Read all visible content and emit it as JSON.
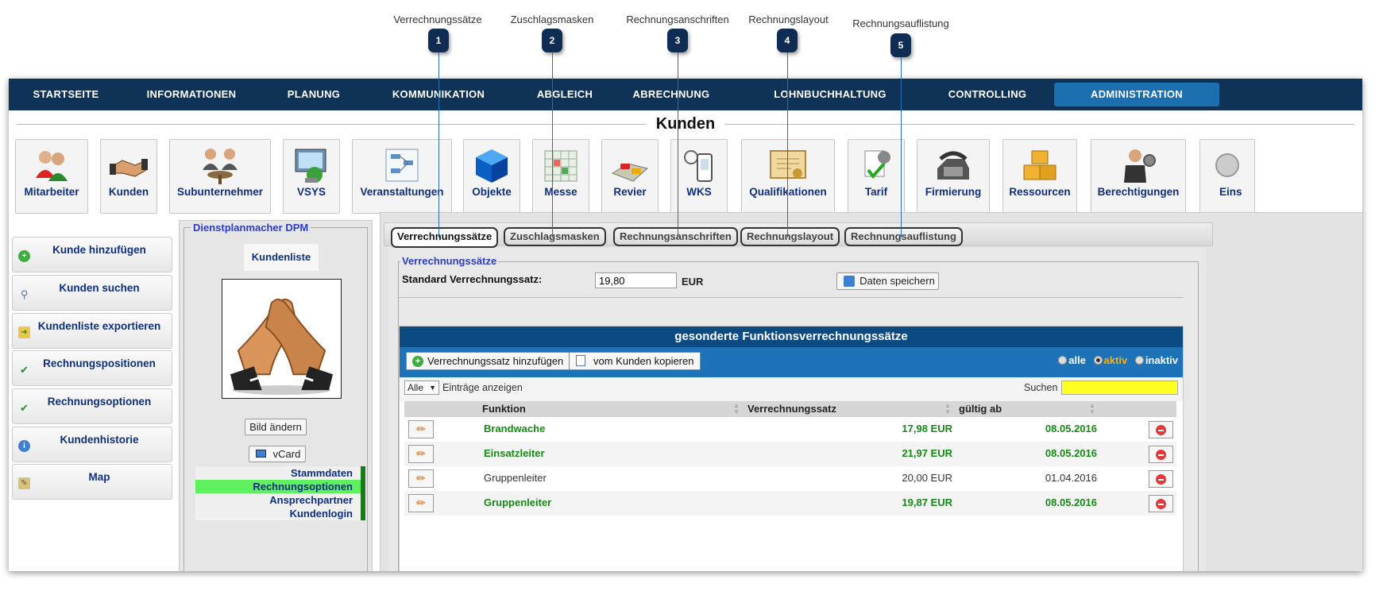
{
  "callouts": [
    {
      "num": "1",
      "label": "Verrechnungssätze"
    },
    {
      "num": "2",
      "label": "Zuschlagsmasken"
    },
    {
      "num": "3",
      "label": "Rechnungsanschriften"
    },
    {
      "num": "4",
      "label": "Rechnungslayout"
    },
    {
      "num": "5",
      "label": "Rechnungsauflistung"
    }
  ],
  "nav": [
    "STARTSEITE",
    "INFORMATIONEN",
    "PLANUNG",
    "KOMMUNIKATION",
    "ABGLEICH",
    "ABRECHNUNG",
    "LOHNBUCHHALTUNG",
    "CONTROLLING",
    "ADMINISTRATION"
  ],
  "page_title": "Kunden",
  "tiles": [
    {
      "label": "Mitarbeiter",
      "icon": "employees-icon"
    },
    {
      "label": "Kunden",
      "icon": "handshake-icon"
    },
    {
      "label": "Subunternehmer",
      "icon": "subcontractor-icon"
    },
    {
      "label": "VSYS",
      "icon": "monitor-icon"
    },
    {
      "label": "Veranstaltungen",
      "icon": "event-chart-icon"
    },
    {
      "label": "Objekte",
      "icon": "cube-icon"
    },
    {
      "label": "Messe",
      "icon": "calendar-grid-icon"
    },
    {
      "label": "Revier",
      "icon": "map-cars-icon"
    },
    {
      "label": "WKS",
      "icon": "device-icon"
    },
    {
      "label": "Qualifikationen",
      "icon": "certificate-icon"
    },
    {
      "label": "Tarif",
      "icon": "tariff-icon"
    },
    {
      "label": "Firmierung",
      "icon": "telephone-icon"
    },
    {
      "label": "Ressourcen",
      "icon": "boxes-icon"
    },
    {
      "label": "Berechtigungen",
      "icon": "permissions-icon"
    },
    {
      "label": "Eins",
      "icon": "settings-icon"
    }
  ],
  "left_menu": [
    {
      "label": "Kunde hinzufügen",
      "icon": "add-icon"
    },
    {
      "label": "Kunden suchen",
      "icon": "search-icon"
    },
    {
      "label": "Kundenliste exportieren",
      "icon": "export-icon"
    },
    {
      "label": "Rechnungspositionen",
      "icon": "invoice-icon"
    },
    {
      "label": "Rechnungsoptionen",
      "icon": "invoice-options-icon"
    },
    {
      "label": "Kundenhistorie",
      "icon": "info-icon"
    },
    {
      "label": "Map",
      "icon": "map-icon"
    }
  ],
  "customer": {
    "legend": "Dienstplanmacher DPM",
    "tab": "Kundenliste",
    "change_image": "Bild ändern",
    "vcard": "vCard",
    "nav": [
      {
        "label": "Stammdaten",
        "active": false
      },
      {
        "label": "Rechnungsoptionen",
        "active": true
      },
      {
        "label": "Ansprechpartner",
        "active": false
      },
      {
        "label": "Kundenlogin",
        "active": false
      }
    ]
  },
  "tabs": [
    {
      "label": "Verrechnungssätze",
      "active": true
    },
    {
      "label": "Zuschlagsmasken",
      "active": false
    },
    {
      "label": "Rechnungsanschriften",
      "active": false
    },
    {
      "label": "Rechnungslayout",
      "active": false
    },
    {
      "label": "Rechnungsauflistung",
      "active": false
    }
  ],
  "rates": {
    "legend": "Verrechnungssätze",
    "standard_label": "Standard Verrechnungssatz:",
    "standard_value": "19,80",
    "currency": "EUR",
    "save_label": "Daten speichern"
  },
  "table": {
    "title": "gesonderte Funktionsverrechnungssätze",
    "add_label": "Verrechnungssatz hinzufügen",
    "copy_label": "vom Kunden kopieren",
    "filter": {
      "all": "alle",
      "active": "aktiv",
      "inactive": "inaktiv",
      "selected": "aktiv"
    },
    "page_size": "Alle",
    "entries_label": "Einträge anzeigen",
    "search_label": "Suchen",
    "search_value": "",
    "columns": [
      "Funktion",
      "Verrechnungssatz",
      "gültig ab"
    ],
    "rows": [
      {
        "funktion": "Brandwache",
        "satz": "17,98 EUR",
        "gueltig": "08.05.2016",
        "active": true
      },
      {
        "funktion": "Einsatzleiter",
        "satz": "21,97 EUR",
        "gueltig": "08.05.2016",
        "active": true
      },
      {
        "funktion": "Gruppenleiter",
        "satz": "20,00 EUR",
        "gueltig": "01.04.2016",
        "active": false
      },
      {
        "funktion": "Gruppenleiter",
        "satz": "19,87 EUR",
        "gueltig": "08.05.2016",
        "active": true
      }
    ]
  },
  "colors": {
    "nav_bg": "#0f3257",
    "nav_active": "#1b6fae",
    "link_blue": "#0e2f80",
    "active_green": "#168a16",
    "table_head": "#0c4a82",
    "table_toolbar": "#1d72b8",
    "search_highlight": "#ffff22"
  }
}
